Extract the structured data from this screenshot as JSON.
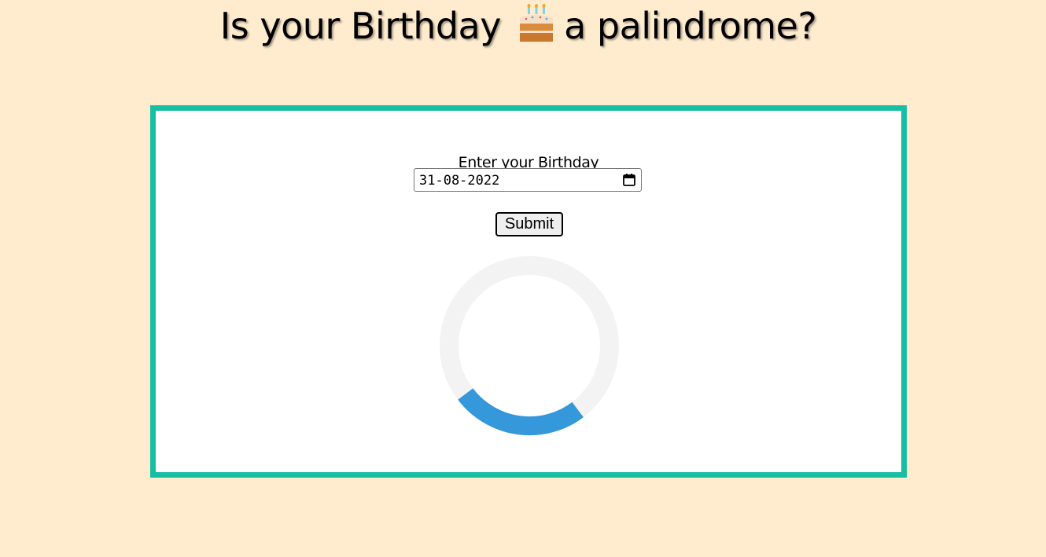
{
  "header": {
    "title_before": "Is your Birthday",
    "title_after": "a palindrome?",
    "title_icon": "birthday-cake-icon"
  },
  "form": {
    "label": "Enter your Birthday",
    "date_value": "31-08-2022",
    "calendar_icon": "calendar-icon",
    "submit_label": "Submit"
  },
  "loader": {
    "icon": "loading-spinner-icon",
    "track_color": "#f3f3f3",
    "arc_color": "#3498db"
  },
  "colors": {
    "background": "#ffebcd",
    "card_border": "#16bea3",
    "card_background": "#ffffff"
  }
}
